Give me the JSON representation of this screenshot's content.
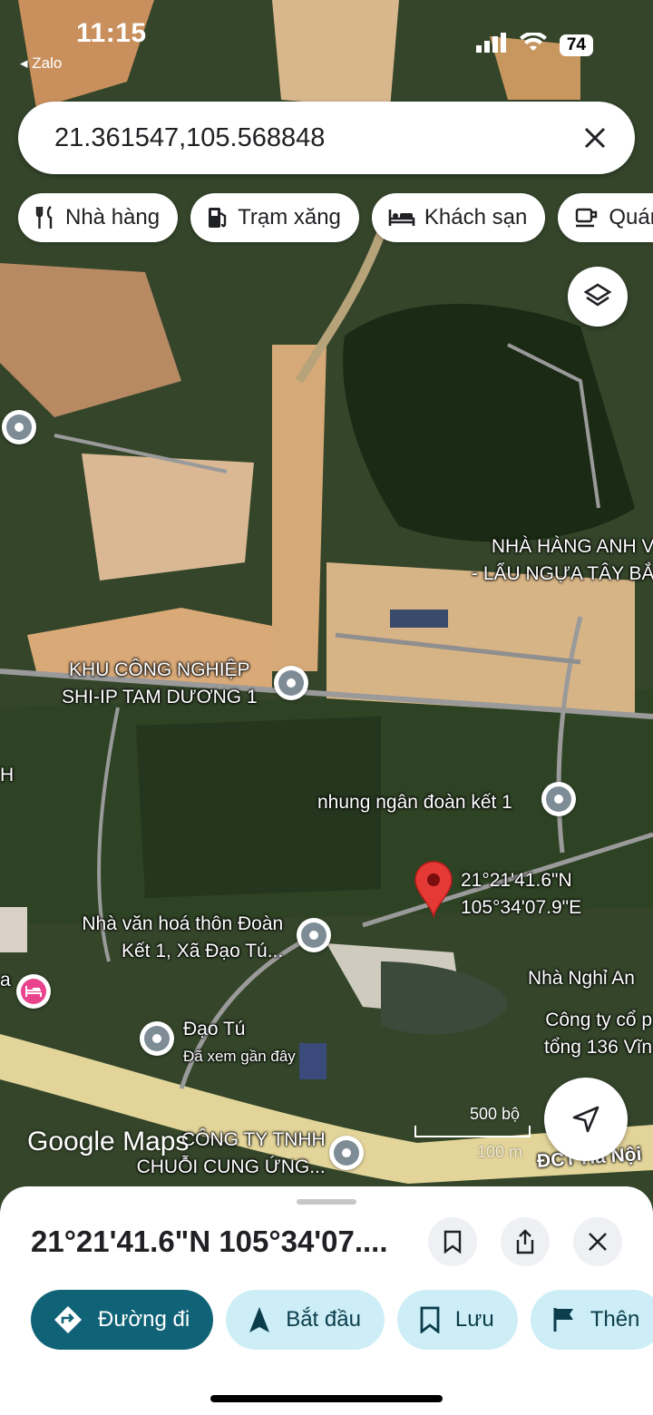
{
  "status_bar": {
    "time": "11:15",
    "back_app": "◂ Zalo",
    "battery": "74"
  },
  "search": {
    "query": "21.361547,105.568848"
  },
  "chips": [
    {
      "label": "Nhà hàng",
      "icon": "fork-knife-icon"
    },
    {
      "label": "Trạm xăng",
      "icon": "gas-station-icon"
    },
    {
      "label": "Khách sạn",
      "icon": "bed-icon"
    },
    {
      "label": "Quán",
      "icon": "cafe-icon"
    }
  ],
  "map_labels": {
    "restaurant_line1": "NHÀ HÀNG ANH V",
    "restaurant_line2": "- LẨU NGỰA TÂY BẮ",
    "industrial_line1": "KHU CÔNG NGHIỆP",
    "industrial_line2": "SHI-IP TAM DƯƠNG 1",
    "nhung": "nhung ngân đoàn kết 1",
    "pin_lat": "21°21'41.6\"N",
    "pin_lng": "105°34'07.9\"E",
    "cultural_line1": "Nhà văn hoá thôn Đoàn",
    "cultural_line2": "Kết 1, Xã Đạo Tú...",
    "guesthouse": "Nhà Nghỉ An",
    "company_line1": "Công ty cổ p",
    "company_line2": "tổng 136 Vĩn",
    "dao_tu": "Đạo Tú",
    "dao_tu_sub": "Đã xem gần đây",
    "tnhh_line1": "CÔNG TY TNHH",
    "tnhh_line2": "CHUỖI CUNG ỨNG...",
    "left_h": "H",
    "left_a": "a",
    "road": "ĐCT Hà Nội",
    "scale_label": "500 bộ",
    "scale_label2": "100 m",
    "watermark": "Google Maps"
  },
  "sheet": {
    "coordinates": "21°21'41.6\"N 105°34'07....",
    "actions": [
      {
        "label": "Đường đi",
        "icon": "directions-icon"
      },
      {
        "label": "Bắt đầu",
        "icon": "navigation-arrow-icon"
      },
      {
        "label": "Lưu",
        "icon": "bookmark-icon"
      },
      {
        "label": "Thên",
        "icon": "flag-icon"
      }
    ]
  },
  "colors": {
    "pin": "#e53935",
    "primary_button": "#106377",
    "secondary_button": "#cdeef6",
    "poi": "#7e8c96",
    "hotel_poi": "#e8438c"
  }
}
